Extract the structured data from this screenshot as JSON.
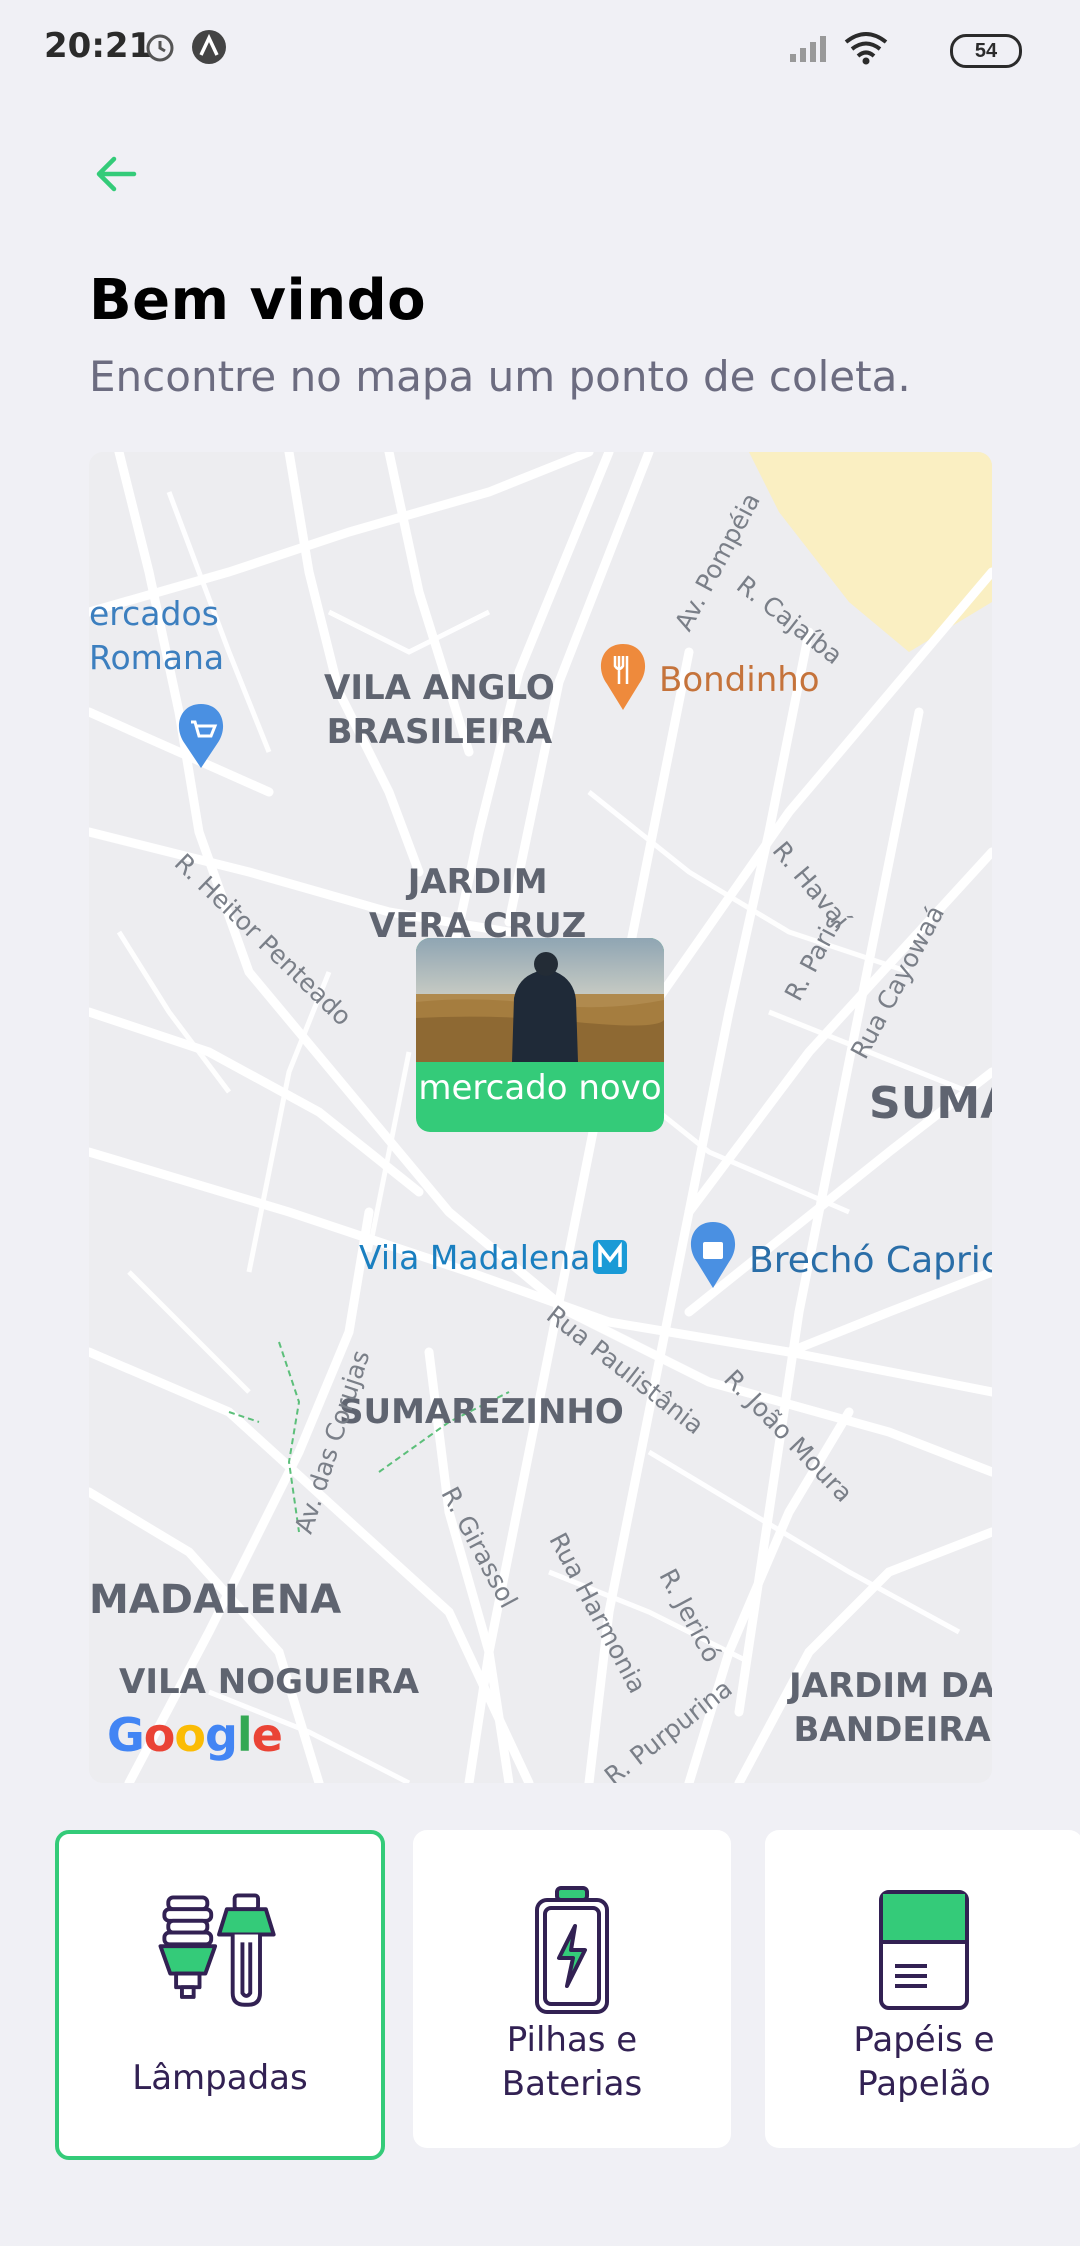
{
  "status_bar": {
    "time": "20:21",
    "battery": "54",
    "icons": [
      "alarm-icon",
      "app-notification-icon",
      "signal-icon",
      "wifi-icon",
      "battery-icon"
    ]
  },
  "header": {
    "back_icon": "arrow-left-icon",
    "title": "Bem vindo",
    "subtitle": "Encontre no mapa um ponto de coleta."
  },
  "map": {
    "districts": [
      "VILA ANGLO\nBRASILEIRA",
      "JARDIM\nVERA CRUZ",
      "SUMA",
      "SUMAREZINHO",
      "MADALENA",
      "VILA NOGUEIRA",
      "JARDIM DAS\nBANDEIRAS"
    ],
    "streets": [
      "Av. Pompéia",
      "R. Cajaíba",
      "R. Havaí",
      "R. Paris",
      "Rua Cayowaá",
      "R. Heitor Penteado",
      "Rua Paulistânia",
      "R. João Moura",
      "Av. das Corujas",
      "R. Girassol",
      "Rua Harmonia",
      "R. Jericó",
      "R. Purpurina"
    ],
    "pois": {
      "mercados": "ercados\nRomana",
      "bondinho": "Bondinho",
      "vila_madalena": "Vila Madalena",
      "brecho": "Brechó Caprich"
    },
    "marker": {
      "label": "mercado novo"
    },
    "google": "Google"
  },
  "items": [
    {
      "label": "Lâmpadas",
      "icon": "lightbulb-icon",
      "selected": true
    },
    {
      "label": "Pilhas e\nBaterias",
      "icon": "battery-icon",
      "selected": false
    },
    {
      "label": "Papéis e\nPapelão",
      "icon": "paper-icon",
      "selected": false
    }
  ],
  "colors": {
    "accent": "#34cb79",
    "background": "#f0f0f5",
    "text_dark": "#322153",
    "text_muted": "#6c6c80"
  }
}
